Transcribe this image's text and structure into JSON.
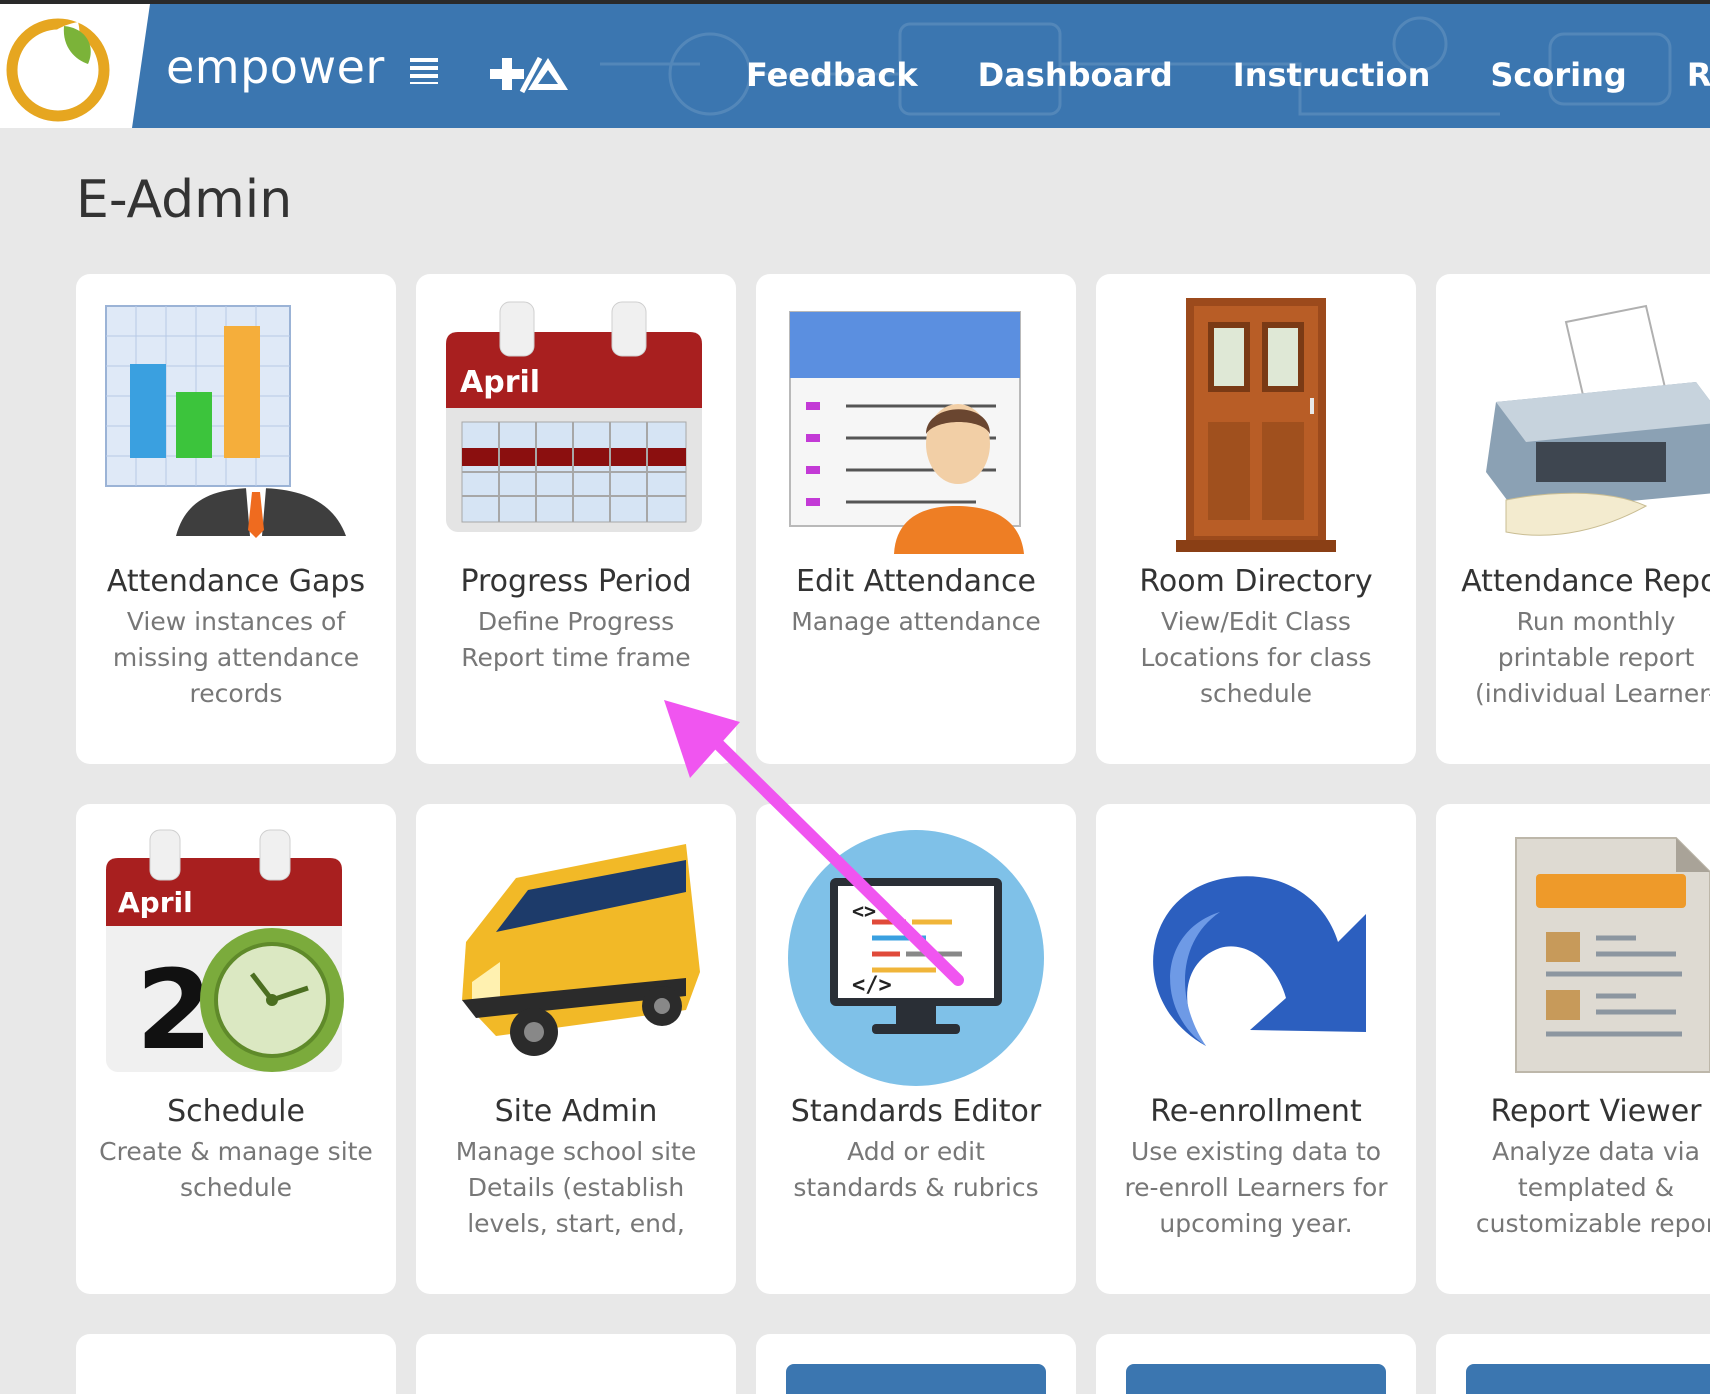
{
  "header": {
    "brand": "empower",
    "nav": [
      "Feedback",
      "Dashboard",
      "Instruction",
      "Scoring",
      "Report"
    ],
    "accent_color": "#3b76b0"
  },
  "page": {
    "title": "E-Admin"
  },
  "cards": [
    {
      "title": "Attendance Gaps",
      "desc": [
        "View instances of",
        "missing attendance",
        "records"
      ],
      "icon": "attendance-chart-icon"
    },
    {
      "title": "Progress Period",
      "desc": [
        "Define Progress",
        "Report time frame"
      ],
      "icon": "calendar-icon",
      "calendar_label": "April"
    },
    {
      "title": "Edit Attendance",
      "desc": [
        "Manage attendance"
      ],
      "icon": "attendance-list-icon"
    },
    {
      "title": "Room Directory",
      "desc": [
        "View/Edit Class",
        "Locations for class",
        "schedule"
      ],
      "icon": "door-icon"
    },
    {
      "title": "Attendance Repor",
      "desc": [
        "Run monthly",
        "printable report",
        "(individual Learner-"
      ],
      "icon": "printer-icon"
    },
    {
      "title": "Schedule",
      "desc": [
        "Create & manage site",
        "schedule"
      ],
      "icon": "calendar-clock-icon",
      "calendar_label": "April",
      "calendar_day": "2"
    },
    {
      "title": "Site Admin",
      "desc": [
        "Manage school site",
        "Details (establish",
        "levels, start, end,"
      ],
      "icon": "school-bus-icon"
    },
    {
      "title": "Standards Editor",
      "desc": [
        "Add or edit",
        "standards & rubrics"
      ],
      "icon": "code-monitor-icon"
    },
    {
      "title": "Re-enrollment",
      "desc": [
        "Use existing data to",
        "re-enroll Learners for",
        "upcoming year."
      ],
      "icon": "redo-arrow-icon"
    },
    {
      "title": "Report Viewer",
      "desc": [
        "Analyze data via",
        "templated &",
        "customizable repor"
      ],
      "icon": "report-document-icon"
    }
  ],
  "annotation": {
    "color": "#f055f0"
  }
}
